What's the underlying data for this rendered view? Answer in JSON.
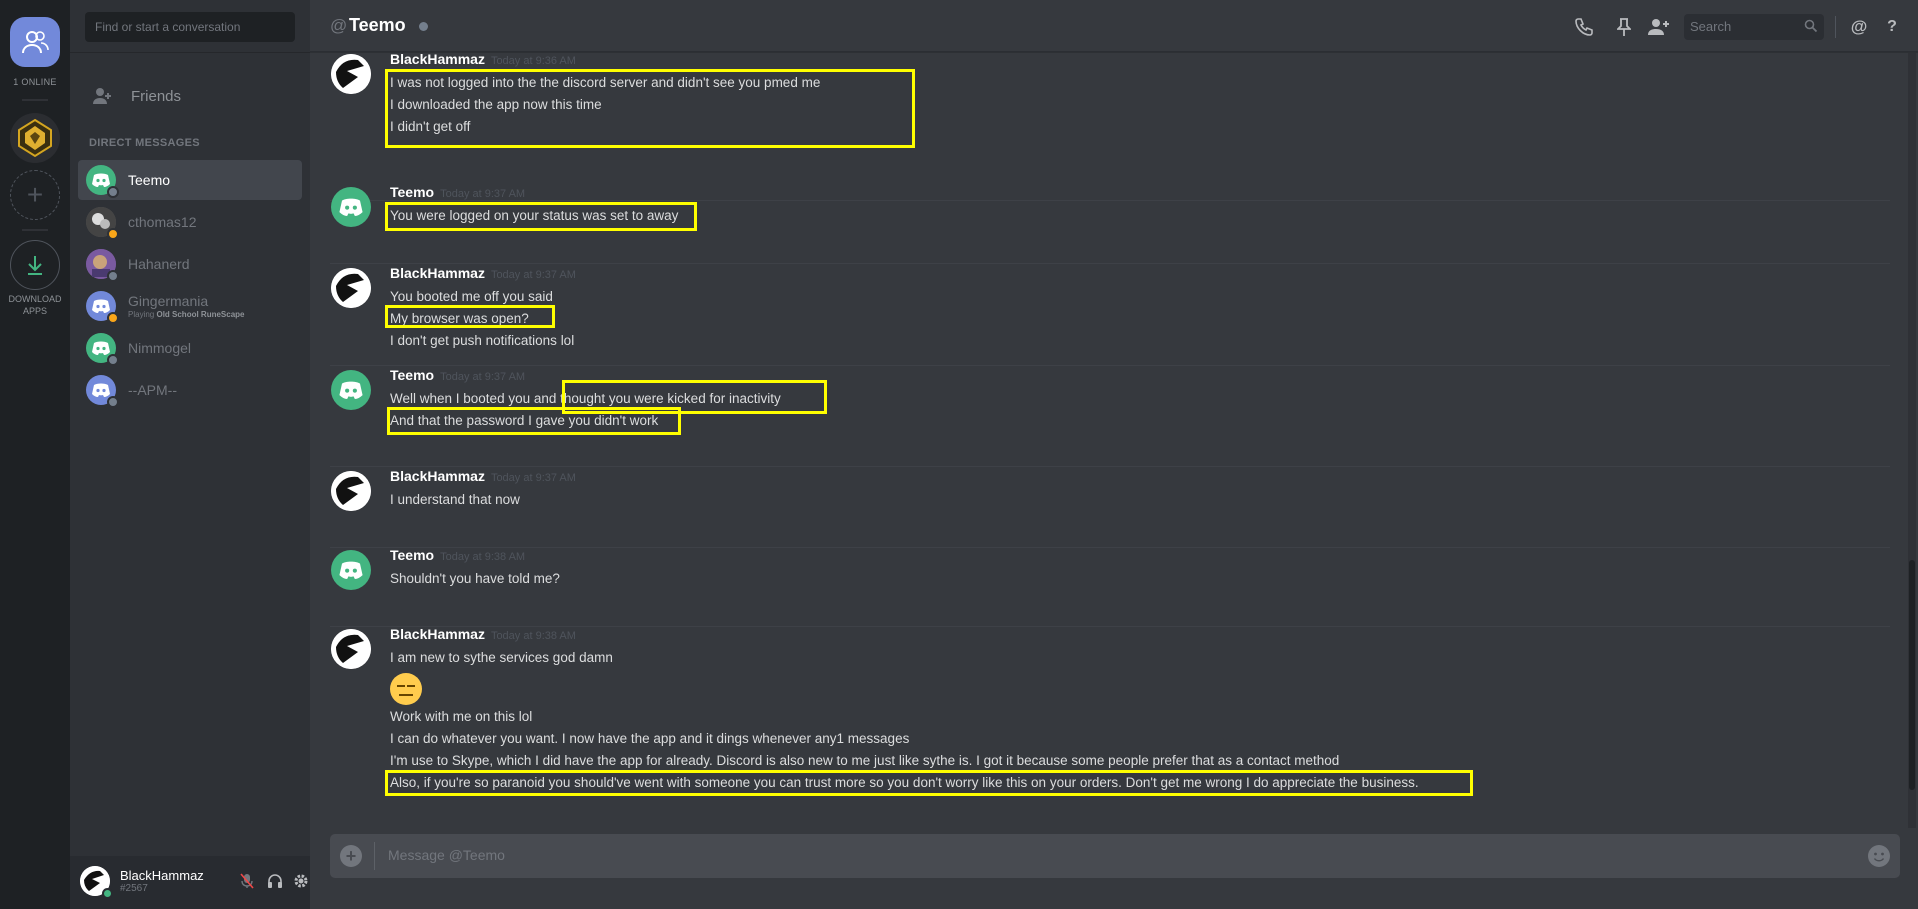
{
  "rail": {
    "online_label": "1 ONLINE",
    "download_label_line1": "DOWNLOAD",
    "download_label_line2": "APPS"
  },
  "sidebar": {
    "search_placeholder": "Find or start a conversation",
    "friends_label": "Friends",
    "dm_header": "DIRECT MESSAGES",
    "dms": [
      {
        "name": "Teemo",
        "sub": "",
        "status_color": "#747f8d",
        "avatar": "discord-green"
      },
      {
        "name": "cthomas12",
        "sub": "",
        "status_color": "#faa61a",
        "avatar": "photo"
      },
      {
        "name": "Hahanerd",
        "sub": "",
        "status_color": "#747f8d",
        "avatar": "photo"
      },
      {
        "name": "Gingermania",
        "sub_prefix": "Playing ",
        "sub": "Old School RuneScape",
        "status_color": "#faa61a",
        "avatar": "discord-blue"
      },
      {
        "name": "Nimmogel",
        "sub": "",
        "status_color": "#747f8d",
        "avatar": "discord-green"
      },
      {
        "name": "--APM--",
        "sub": "",
        "status_color": "#747f8d",
        "avatar": "discord-blue"
      }
    ]
  },
  "user": {
    "name": "BlackHammaz",
    "tag": "#2567"
  },
  "header": {
    "at": "@",
    "channel_name": "Teemo",
    "search_placeholder": "Search",
    "help": "?",
    "mention": "@"
  },
  "messages": [
    {
      "author": "BlackHammaz",
      "time": "Today at 9:36 AM",
      "avatar": "black",
      "lines": [
        "I was not logged into the the discord server and didn't see you pmed me",
        "I downloaded the app now this time",
        "I didn't get off"
      ]
    },
    {
      "author": "Teemo",
      "time": "Today at 9:37 AM",
      "avatar": "discord",
      "lines": [
        "You were logged on your status was set to away"
      ]
    },
    {
      "author": "BlackHammaz",
      "time": "Today at 9:37 AM",
      "avatar": "black",
      "lines": [
        "You booted me off you said",
        "My browser was open?",
        "I don't get push notifications lol"
      ]
    },
    {
      "author": "Teemo",
      "time": "Today at 9:37 AM",
      "avatar": "discord",
      "lines": [
        "Well when I booted you and thought you were kicked for inactivity",
        "And that the password I gave you didn't work"
      ]
    },
    {
      "author": "BlackHammaz",
      "time": "Today at 9:37 AM",
      "avatar": "black",
      "lines": [
        "I understand that now"
      ]
    },
    {
      "author": "Teemo",
      "time": "Today at 9:38 AM",
      "avatar": "discord",
      "lines": [
        "Shouldn't you have told me?"
      ]
    },
    {
      "author": "BlackHammaz",
      "time": "Today at 9:38 AM",
      "avatar": "black",
      "emoji": "expressionless",
      "lines": [
        "I am new to sythe services god damn",
        "Work with me on this lol",
        "I can do whatever you want. I now have the app and it dings whenever any1 messages",
        "I'm use to Skype, which I did have the app for already. Discord is also new to me just like sythe is. I got it because some people prefer that as a contact method",
        "Also, if you're so paranoid you should've went with someone you can trust more so you don't worry like this on your orders. Don't get me wrong I do appreciate the business."
      ]
    }
  ],
  "composer": {
    "placeholder": "Message @Teemo"
  },
  "colors": {
    "accent": "#7289da",
    "online": "#43b581",
    "idle": "#faa61a",
    "offline": "#747f8d",
    "highlight": "#ffff00"
  }
}
